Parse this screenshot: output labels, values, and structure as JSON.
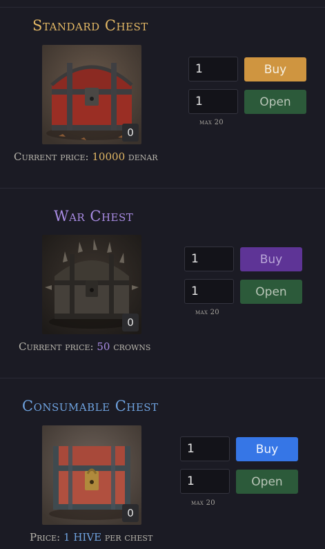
{
  "colors": {
    "background": "#1b1b24",
    "gold": "#e3b865",
    "purple": "#a98ce4",
    "blue": "#6fa3e0",
    "buy_gold": "#cf9540",
    "buy_purple": "#5e3496",
    "buy_blue": "#3676e6",
    "open_green": "#2c5a3a"
  },
  "chests": [
    {
      "title": "Standard Chest",
      "count": "0",
      "price_label": "Current price:",
      "price_value": "10000",
      "price_unit": "denar",
      "buy_qty": "1",
      "buy_label": "Buy",
      "open_qty": "1",
      "open_label": "Open",
      "max_note": "max 20"
    },
    {
      "title": "War Chest",
      "count": "0",
      "price_label": "Current price:",
      "price_value": "50",
      "price_unit": "crowns",
      "buy_qty": "1",
      "buy_label": "Buy",
      "open_qty": "1",
      "open_label": "Open",
      "max_note": "max 20"
    },
    {
      "title": "Consumable Chest",
      "count": "0",
      "price_label": "Price:",
      "price_value": "1 HIVE",
      "price_unit": "per chest",
      "buy_qty": "1",
      "buy_label": "Buy",
      "open_qty": "1",
      "open_label": "Open",
      "max_note": "max 20"
    }
  ]
}
